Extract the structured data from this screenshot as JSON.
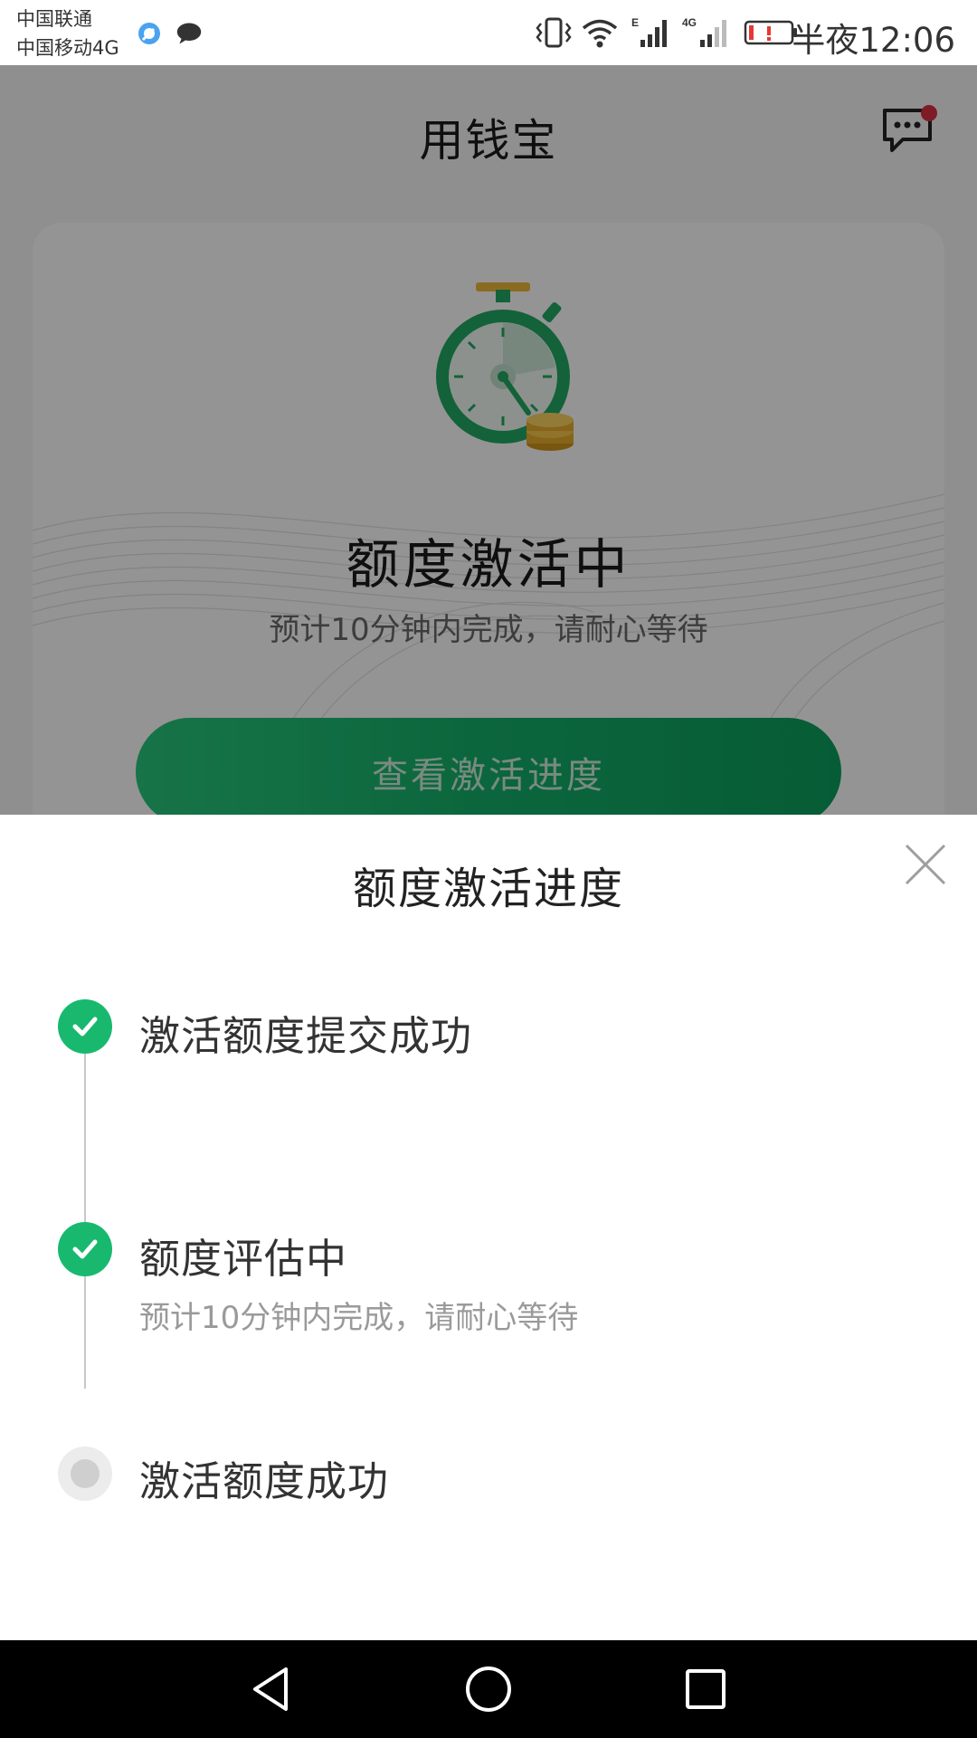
{
  "status_bar": {
    "carrier_1": "中国联通",
    "carrier_2": "中国移动4G",
    "notification_icons": [
      "browser-icon",
      "chat-bubble-icon"
    ],
    "system_icons": [
      "vibrate-icon",
      "wifi-icon",
      "signal-e-icon",
      "signal-4g-icon",
      "battery-low-icon"
    ],
    "clock": "半夜12:06"
  },
  "header": {
    "title": "用钱宝",
    "message_icon": "message-icon"
  },
  "card": {
    "icon": "stopwatch-coins-icon",
    "title": "额度激活中",
    "subtitle": "预计10分钟内完成，请耐心等待",
    "button_label": "查看激活进度"
  },
  "sheet": {
    "title": "额度激活进度",
    "close_icon": "close-icon",
    "steps": [
      {
        "label": "激活额度提交成功",
        "status": "done"
      },
      {
        "label": "额度评估中",
        "sub": "预计10分钟内完成，请耐心等待",
        "status": "done"
      },
      {
        "label": "激活额度成功",
        "status": "pending"
      }
    ]
  },
  "nav_bar": {
    "buttons": [
      "back-icon",
      "home-icon",
      "recent-apps-icon"
    ]
  },
  "colors": {
    "brand_green": "#18b96f",
    "pending_grey": "#cfcfcf",
    "badge_red": "#d32f3f"
  }
}
